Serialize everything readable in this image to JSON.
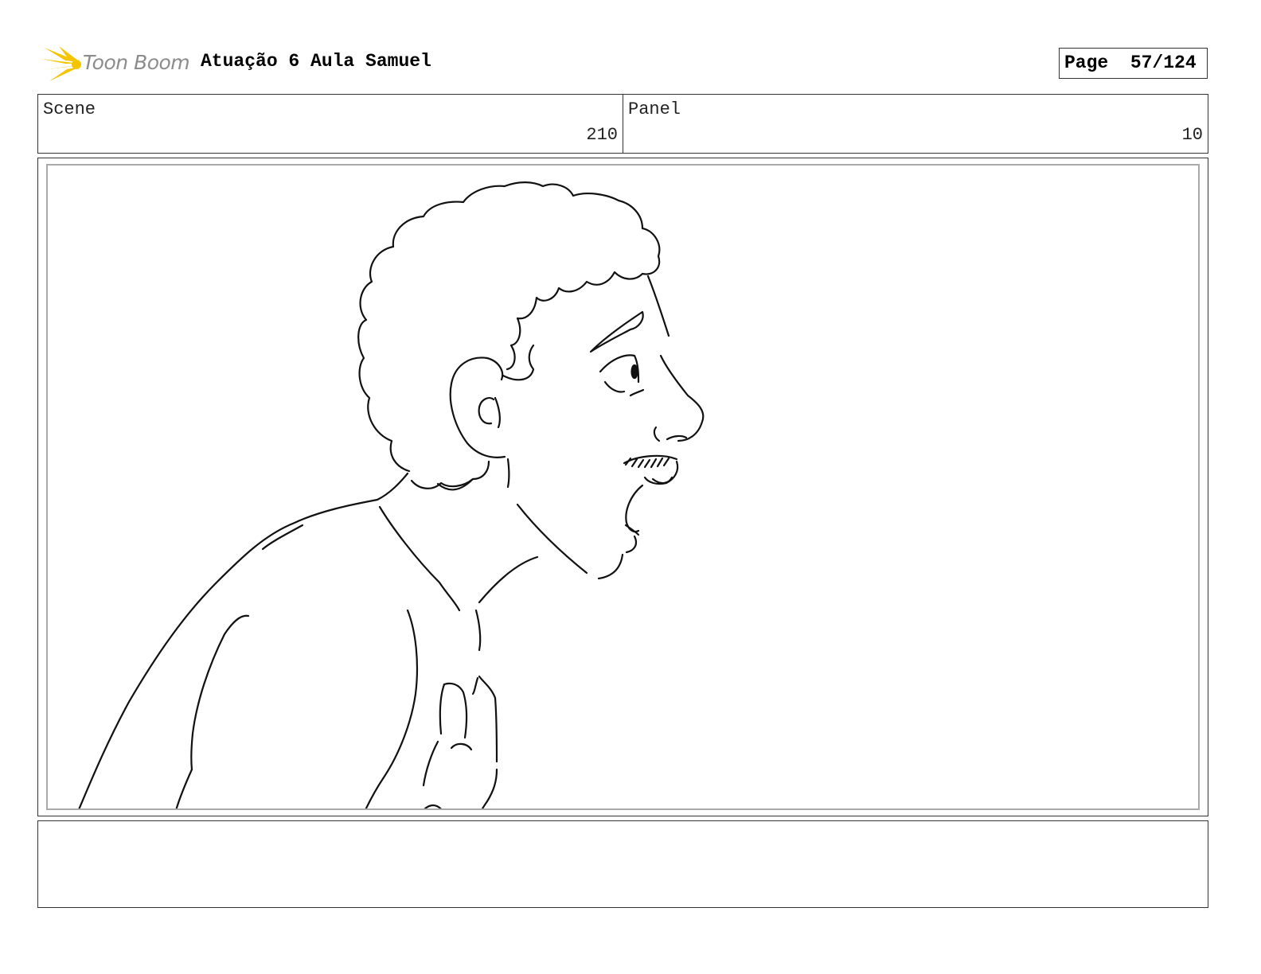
{
  "header": {
    "logo_text": "Toon Boom",
    "title": "Atuação 6 Aula Samuel",
    "page_label": "Page",
    "page_value": "57/124"
  },
  "info": {
    "scene_label": "Scene",
    "scene_value": "210",
    "panel_label": "Panel",
    "panel_value": "10"
  },
  "colors": {
    "logo_yellow": "#f5c400",
    "logo_gray": "#8c8c8c"
  }
}
